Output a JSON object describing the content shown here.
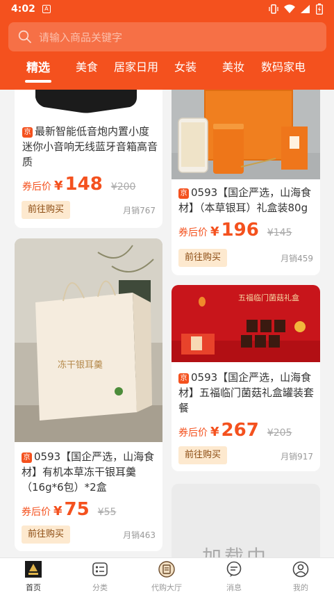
{
  "status_bar": {
    "time": "4:02"
  },
  "search": {
    "placeholder": "请输入商品关键字"
  },
  "tabs": [
    "精选",
    "美食",
    "居家日用",
    "女装",
    "美妆",
    "数码家电"
  ],
  "products": [
    {
      "title": "最新智能低音炮内置小度迷你小音响无线蓝牙音箱高音质",
      "price_label": "券后价",
      "currency": "¥",
      "price": "148",
      "original_price": "¥200",
      "buy_label": "前往购买",
      "sales": "月销767"
    },
    {
      "title": "0593【国企严选，山海食材】（本草银耳）礼盒装80g",
      "price_label": "券后价",
      "currency": "¥",
      "price": "196",
      "original_price": "¥145",
      "buy_label": "前往购买",
      "sales": "月销459"
    },
    {
      "title": "0593【国企严选，山海食材】有机本草冻干银耳羹（16g*6包）*2盒",
      "price_label": "券后价",
      "currency": "¥",
      "price": "75",
      "original_price": "¥55",
      "buy_label": "前往购买",
      "sales": "月销463"
    },
    {
      "title": "0593【国企严选，山海食材】五福临门菌菇礼盒罐装套餐",
      "price_label": "券后价",
      "currency": "¥",
      "price": "267",
      "original_price": "¥205",
      "buy_label": "前往购买",
      "sales": "月销917"
    }
  ],
  "loading_text": "加载中",
  "image_texts": {
    "bag_text": "冻干银耳羹",
    "banner_text": "五福临门菌菇礼盒"
  },
  "bottom_nav": [
    {
      "label": "首页",
      "icon": "home-logo-icon"
    },
    {
      "label": "分类",
      "icon": "category-icon"
    },
    {
      "label": "代购大厅",
      "icon": "purchase-hall-icon"
    },
    {
      "label": "消息",
      "icon": "message-icon"
    },
    {
      "label": "我的",
      "icon": "user-icon"
    }
  ],
  "colors": {
    "primary": "#f4511e",
    "price": "#f4511e",
    "button_bg": "#fde9cf"
  }
}
